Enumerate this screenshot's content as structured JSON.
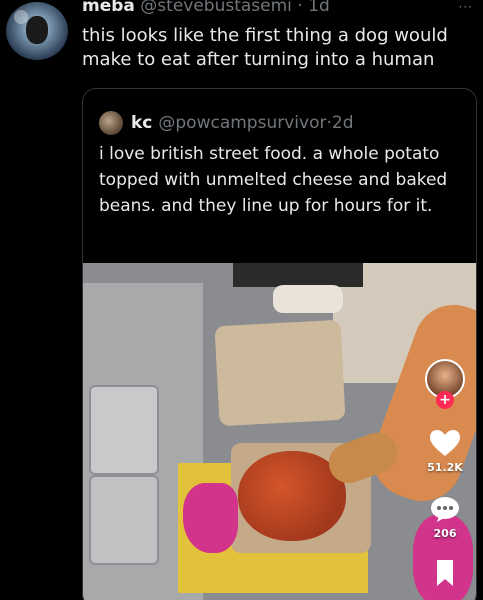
{
  "tweet": {
    "name": "meba",
    "handle": "@stevebustasemi",
    "separator": "·",
    "time": "1d",
    "more": "···",
    "text": "this looks like the first thing a dog would make to eat after turning into a human"
  },
  "quote": {
    "name": "kc",
    "handle": "@powcampsurvivor",
    "separator": "·",
    "time": "2d",
    "text": "i love british street food. a whole potato topped with unmelted cheese and baked beans. and they line up for hours for it."
  },
  "tiktok": {
    "follow_symbol": "+",
    "likes": "51.2K",
    "comments": "206",
    "icons": [
      "heart-icon",
      "comment-icon",
      "bookmark-icon"
    ],
    "accent": "#fe2c55"
  },
  "colors": {
    "background": "#000000",
    "text": "#e7e9ea",
    "muted": "#71767b",
    "border": "#2f3336"
  }
}
